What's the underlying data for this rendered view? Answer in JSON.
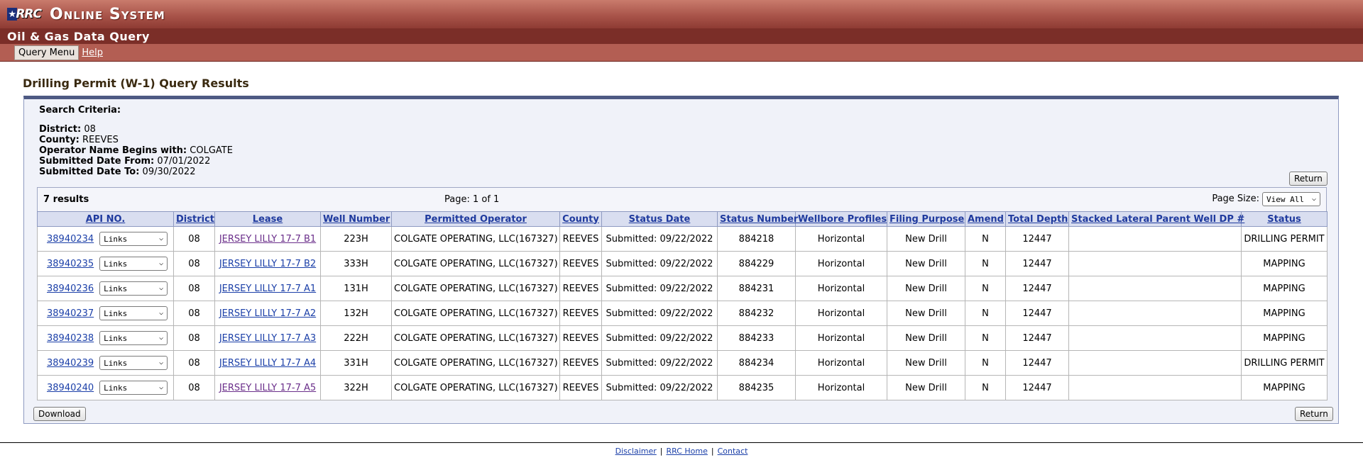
{
  "header": {
    "logo_text": "RRC",
    "system_title": "Online System",
    "app_title": "Oil & Gas Data Query",
    "menu_button": "Query Menu",
    "help_link": "Help"
  },
  "page_title": "Drilling Permit (W-1) Query Results",
  "criteria": {
    "heading": "Search Criteria:",
    "items": [
      {
        "label": "District:",
        "value": "08"
      },
      {
        "label": "County:",
        "value": "REEVES"
      },
      {
        "label": "Operator Name Begins with:",
        "value": "COLGATE"
      },
      {
        "label": "Submitted Date From:",
        "value": "07/01/2022"
      },
      {
        "label": "Submitted Date To:",
        "value": "09/30/2022"
      }
    ]
  },
  "buttons": {
    "return": "Return",
    "download": "Download"
  },
  "results": {
    "count": "7 results",
    "page_info": "Page: 1 of 1",
    "page_size_label": "Page Size:",
    "page_size_value": "View All",
    "links_select": "Links",
    "columns": [
      "API NO.",
      "District",
      "Lease",
      "Well Number",
      "Permitted Operator",
      "County",
      "Status Date",
      "Status Number",
      "Wellbore Profiles",
      "Filing Purpose",
      "Amend",
      "Total Depth",
      "Stacked Lateral Parent Well DP #",
      "Status"
    ],
    "rows": [
      {
        "api": "38940234",
        "district": "08",
        "lease": "JERSEY LILLY 17-7 B1",
        "well": "223H",
        "operator": "COLGATE OPERATING, LLC(167327)",
        "county": "REEVES",
        "status_date": "Submitted: 09/22/2022",
        "status_number": "884218",
        "profile": "Horizontal",
        "purpose": "New Drill",
        "amend": "N",
        "depth": "12447",
        "stacked": "",
        "status": "DRILLING PERMIT"
      },
      {
        "api": "38940235",
        "district": "08",
        "lease": "JERSEY LILLY 17-7 B2",
        "well": "333H",
        "operator": "COLGATE OPERATING, LLC(167327)",
        "county": "REEVES",
        "status_date": "Submitted: 09/22/2022",
        "status_number": "884229",
        "profile": "Horizontal",
        "purpose": "New Drill",
        "amend": "N",
        "depth": "12447",
        "stacked": "",
        "status": "MAPPING"
      },
      {
        "api": "38940236",
        "district": "08",
        "lease": "JERSEY LILLY 17-7 A1",
        "well": "131H",
        "operator": "COLGATE OPERATING, LLC(167327)",
        "county": "REEVES",
        "status_date": "Submitted: 09/22/2022",
        "status_number": "884231",
        "profile": "Horizontal",
        "purpose": "New Drill",
        "amend": "N",
        "depth": "12447",
        "stacked": "",
        "status": "MAPPING"
      },
      {
        "api": "38940237",
        "district": "08",
        "lease": "JERSEY LILLY 17-7 A2",
        "well": "132H",
        "operator": "COLGATE OPERATING, LLC(167327)",
        "county": "REEVES",
        "status_date": "Submitted: 09/22/2022",
        "status_number": "884232",
        "profile": "Horizontal",
        "purpose": "New Drill",
        "amend": "N",
        "depth": "12447",
        "stacked": "",
        "status": "MAPPING"
      },
      {
        "api": "38940238",
        "district": "08",
        "lease": "JERSEY LILLY 17-7 A3",
        "well": "222H",
        "operator": "COLGATE OPERATING, LLC(167327)",
        "county": "REEVES",
        "status_date": "Submitted: 09/22/2022",
        "status_number": "884233",
        "profile": "Horizontal",
        "purpose": "New Drill",
        "amend": "N",
        "depth": "12447",
        "stacked": "",
        "status": "MAPPING"
      },
      {
        "api": "38940239",
        "district": "08",
        "lease": "JERSEY LILLY 17-7 A4",
        "well": "331H",
        "operator": "COLGATE OPERATING, LLC(167327)",
        "county": "REEVES",
        "status_date": "Submitted: 09/22/2022",
        "status_number": "884234",
        "profile": "Horizontal",
        "purpose": "New Drill",
        "amend": "N",
        "depth": "12447",
        "stacked": "",
        "status": "DRILLING PERMIT"
      },
      {
        "api": "38940240",
        "district": "08",
        "lease": "JERSEY LILLY 17-7 A5",
        "well": "322H",
        "operator": "COLGATE OPERATING, LLC(167327)",
        "county": "REEVES",
        "status_date": "Submitted: 09/22/2022",
        "status_number": "884235",
        "profile": "Horizontal",
        "purpose": "New Drill",
        "amend": "N",
        "depth": "12447",
        "stacked": "",
        "status": "MAPPING"
      }
    ]
  },
  "footer": {
    "links": [
      "Disclaimer",
      "RRC Home",
      "Contact"
    ]
  },
  "icons": [
    "star-icon",
    "chevron-down-icon"
  ],
  "colors": {
    "banner": "#a9544a",
    "appbar": "#7b2e28",
    "menubar": "#b35e53",
    "panel_border": "#4e5a83",
    "link": "#1b3fa8"
  }
}
